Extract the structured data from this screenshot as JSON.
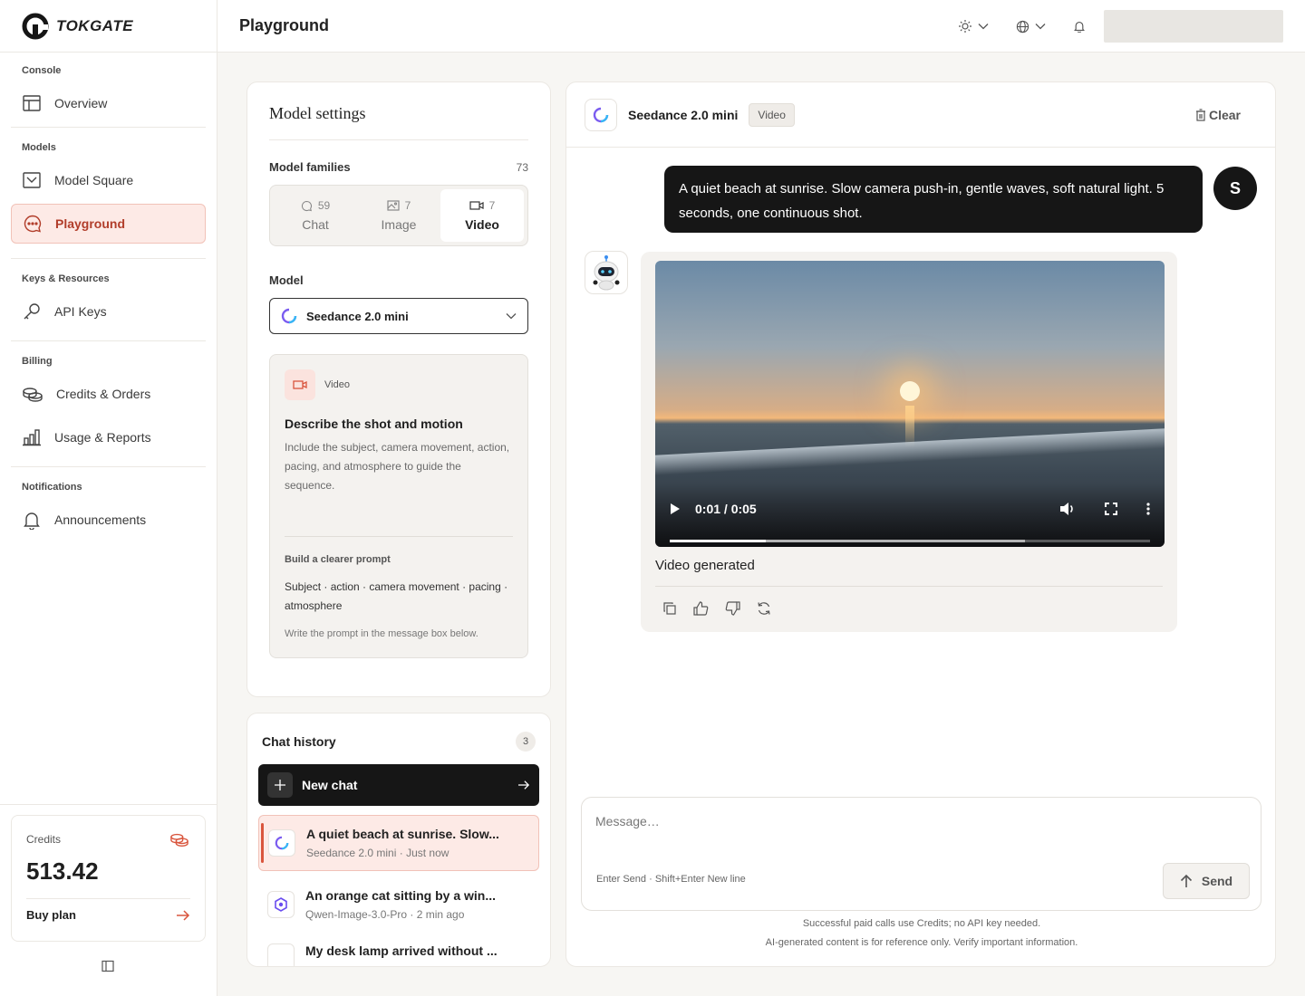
{
  "brand": {
    "name": "TOKGATE"
  },
  "header": {
    "title": "Playground"
  },
  "sidebar": {
    "sections": [
      {
        "title": "Console",
        "items": [
          {
            "label": "Overview",
            "icon": "layout-icon"
          }
        ]
      },
      {
        "title": "Models",
        "items": [
          {
            "label": "Model Square",
            "icon": "inbox-icon"
          },
          {
            "label": "Playground",
            "icon": "chat-bubble-icon",
            "active": true
          }
        ]
      },
      {
        "title": "Keys & Resources",
        "items": [
          {
            "label": "API Keys",
            "icon": "key-icon"
          }
        ]
      },
      {
        "title": "Billing",
        "items": [
          {
            "label": "Credits & Orders",
            "icon": "coins-icon"
          },
          {
            "label": "Usage & Reports",
            "icon": "bar-chart-icon"
          }
        ]
      },
      {
        "title": "Notifications",
        "items": [
          {
            "label": "Announcements",
            "icon": "bell-icon"
          }
        ]
      }
    ],
    "credits": {
      "label": "Credits",
      "value": "513.42",
      "buy_label": "Buy plan"
    }
  },
  "settings": {
    "title": "Model settings",
    "families_label": "Model families",
    "families_count": "73",
    "tabs": [
      {
        "count": "59",
        "label": "Chat",
        "icon": "chat-icon"
      },
      {
        "count": "7",
        "label": "Image",
        "icon": "image-icon"
      },
      {
        "count": "7",
        "label": "Video",
        "icon": "video-icon",
        "active": true
      }
    ],
    "model_label": "Model",
    "model_selected": "Seedance 2.0 mini",
    "info": {
      "tag": "Video",
      "heading": "Describe the shot and motion",
      "desc": "Include the subject, camera movement, action, pacing, and atmosphere to guide the sequence.",
      "sub": "Build a clearer prompt",
      "steps": "Subject · action · camera movement · pacing · atmosphere",
      "note": "Write the prompt in the message box below."
    }
  },
  "history": {
    "title": "Chat history",
    "count": "3",
    "new_chat": "New chat",
    "items": [
      {
        "title": "A quiet beach at sunrise. Slow...",
        "sub": "Seedance 2.0 mini · Just now",
        "active": true
      },
      {
        "title": "An orange cat sitting by a win...",
        "sub": "Qwen-Image-3.0-Pro · 2 min ago"
      },
      {
        "title": "My desk lamp arrived without ...",
        "sub": ""
      }
    ]
  },
  "chat": {
    "model": "Seedance 2.0 mini",
    "type": "Video",
    "clear": "Clear",
    "user_avatar": "S",
    "user_message": "A quiet beach at sunrise. Slow camera push-in, gentle waves, soft natural light. 5 seconds, one continuous shot.",
    "video": {
      "time": "0:01 / 0:05",
      "played": 0.2,
      "buffered": 0.74
    },
    "bot_text": "Video generated",
    "composer": {
      "placeholder": "Message…",
      "hint": "Enter Send · Shift+Enter New line",
      "send": "Send"
    },
    "disclaimer_1": "Successful paid calls use Credits; no API key needed.",
    "disclaimer_2": "AI-generated content is for reference only. Verify important information."
  },
  "colors": {
    "accent": "#d9553d",
    "accent_bg": "#fdeae6",
    "dark": "#161616"
  }
}
